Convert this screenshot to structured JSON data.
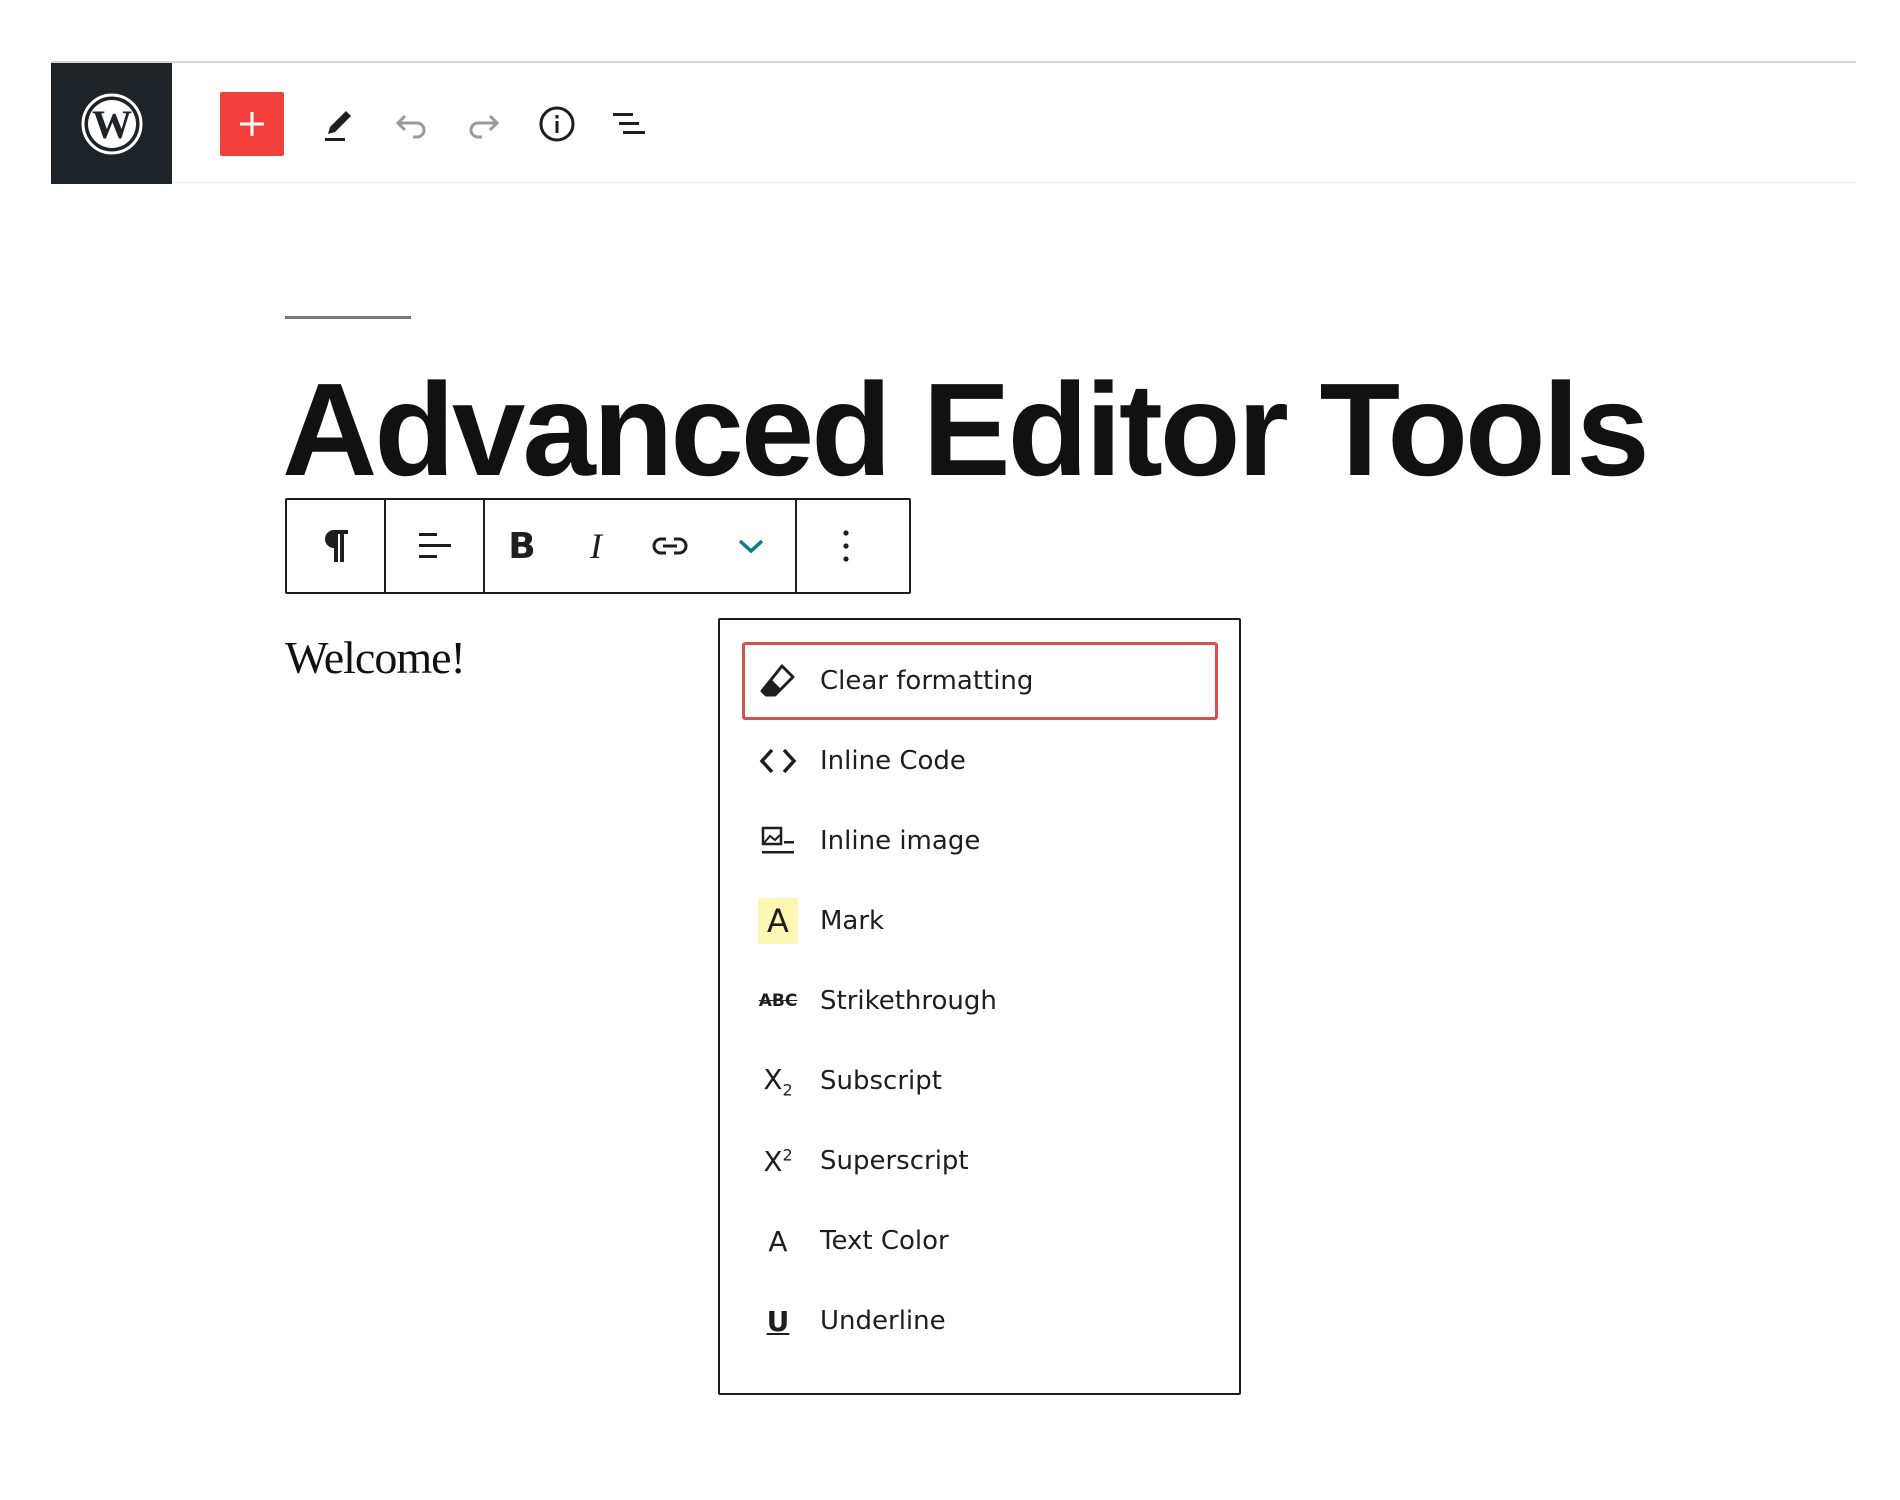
{
  "top_toolbar": {
    "logo": "wordpress-logo",
    "tools": [
      "add-block",
      "edit-tools",
      "undo",
      "redo",
      "details-info",
      "list-view"
    ],
    "accent_color": "#f1403c",
    "logo_bg": "#1d2327"
  },
  "editor": {
    "title": "Advanced Editor Tools",
    "paragraph": "Welcome!"
  },
  "block_toolbar": {
    "groups": [
      [
        "paragraph-type"
      ],
      [
        "align"
      ],
      [
        "bold",
        "italic",
        "link",
        "more-rich-text-controls"
      ],
      [
        "options"
      ]
    ],
    "bold_glyph": "B",
    "italic_glyph": "I",
    "chevron_color": "#0a7c8c"
  },
  "format_menu": {
    "items": [
      {
        "label": "Clear formatting",
        "icon": "eraser-icon",
        "focused": true
      },
      {
        "label": "Inline Code",
        "icon": "code-icon"
      },
      {
        "label": "Inline image",
        "icon": "image-icon"
      },
      {
        "label": "Mark",
        "icon": "mark-icon",
        "glyph": "A",
        "highlight": "#fdf7b6"
      },
      {
        "label": "Strikethrough",
        "icon": "strikethrough-icon",
        "glyph": "ABC"
      },
      {
        "label": "Subscript",
        "icon": "subscript-icon",
        "glyph": "X",
        "script": "2"
      },
      {
        "label": "Superscript",
        "icon": "superscript-icon",
        "glyph": "X",
        "script": "2"
      },
      {
        "label": "Text Color",
        "icon": "text-color-icon",
        "glyph": "A"
      },
      {
        "label": "Underline",
        "icon": "underline-icon",
        "glyph": "U"
      }
    ],
    "focus_color": "#d94f4f"
  }
}
